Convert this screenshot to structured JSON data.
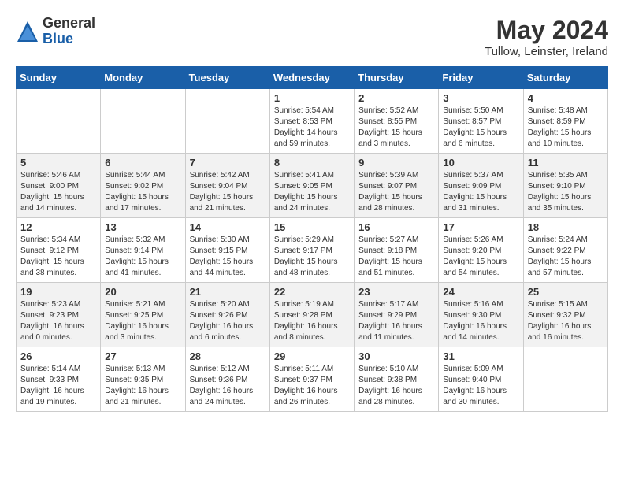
{
  "header": {
    "logo_general": "General",
    "logo_blue": "Blue",
    "month_year": "May 2024",
    "location": "Tullow, Leinster, Ireland"
  },
  "days_of_week": [
    "Sunday",
    "Monday",
    "Tuesday",
    "Wednesday",
    "Thursday",
    "Friday",
    "Saturday"
  ],
  "weeks": [
    [
      {
        "day": "",
        "info": ""
      },
      {
        "day": "",
        "info": ""
      },
      {
        "day": "",
        "info": ""
      },
      {
        "day": "1",
        "info": "Sunrise: 5:54 AM\nSunset: 8:53 PM\nDaylight: 14 hours\nand 59 minutes."
      },
      {
        "day": "2",
        "info": "Sunrise: 5:52 AM\nSunset: 8:55 PM\nDaylight: 15 hours\nand 3 minutes."
      },
      {
        "day": "3",
        "info": "Sunrise: 5:50 AM\nSunset: 8:57 PM\nDaylight: 15 hours\nand 6 minutes."
      },
      {
        "day": "4",
        "info": "Sunrise: 5:48 AM\nSunset: 8:59 PM\nDaylight: 15 hours\nand 10 minutes."
      }
    ],
    [
      {
        "day": "5",
        "info": "Sunrise: 5:46 AM\nSunset: 9:00 PM\nDaylight: 15 hours\nand 14 minutes."
      },
      {
        "day": "6",
        "info": "Sunrise: 5:44 AM\nSunset: 9:02 PM\nDaylight: 15 hours\nand 17 minutes."
      },
      {
        "day": "7",
        "info": "Sunrise: 5:42 AM\nSunset: 9:04 PM\nDaylight: 15 hours\nand 21 minutes."
      },
      {
        "day": "8",
        "info": "Sunrise: 5:41 AM\nSunset: 9:05 PM\nDaylight: 15 hours\nand 24 minutes."
      },
      {
        "day": "9",
        "info": "Sunrise: 5:39 AM\nSunset: 9:07 PM\nDaylight: 15 hours\nand 28 minutes."
      },
      {
        "day": "10",
        "info": "Sunrise: 5:37 AM\nSunset: 9:09 PM\nDaylight: 15 hours\nand 31 minutes."
      },
      {
        "day": "11",
        "info": "Sunrise: 5:35 AM\nSunset: 9:10 PM\nDaylight: 15 hours\nand 35 minutes."
      }
    ],
    [
      {
        "day": "12",
        "info": "Sunrise: 5:34 AM\nSunset: 9:12 PM\nDaylight: 15 hours\nand 38 minutes."
      },
      {
        "day": "13",
        "info": "Sunrise: 5:32 AM\nSunset: 9:14 PM\nDaylight: 15 hours\nand 41 minutes."
      },
      {
        "day": "14",
        "info": "Sunrise: 5:30 AM\nSunset: 9:15 PM\nDaylight: 15 hours\nand 44 minutes."
      },
      {
        "day": "15",
        "info": "Sunrise: 5:29 AM\nSunset: 9:17 PM\nDaylight: 15 hours\nand 48 minutes."
      },
      {
        "day": "16",
        "info": "Sunrise: 5:27 AM\nSunset: 9:18 PM\nDaylight: 15 hours\nand 51 minutes."
      },
      {
        "day": "17",
        "info": "Sunrise: 5:26 AM\nSunset: 9:20 PM\nDaylight: 15 hours\nand 54 minutes."
      },
      {
        "day": "18",
        "info": "Sunrise: 5:24 AM\nSunset: 9:22 PM\nDaylight: 15 hours\nand 57 minutes."
      }
    ],
    [
      {
        "day": "19",
        "info": "Sunrise: 5:23 AM\nSunset: 9:23 PM\nDaylight: 16 hours\nand 0 minutes."
      },
      {
        "day": "20",
        "info": "Sunrise: 5:21 AM\nSunset: 9:25 PM\nDaylight: 16 hours\nand 3 minutes."
      },
      {
        "day": "21",
        "info": "Sunrise: 5:20 AM\nSunset: 9:26 PM\nDaylight: 16 hours\nand 6 minutes."
      },
      {
        "day": "22",
        "info": "Sunrise: 5:19 AM\nSunset: 9:28 PM\nDaylight: 16 hours\nand 8 minutes."
      },
      {
        "day": "23",
        "info": "Sunrise: 5:17 AM\nSunset: 9:29 PM\nDaylight: 16 hours\nand 11 minutes."
      },
      {
        "day": "24",
        "info": "Sunrise: 5:16 AM\nSunset: 9:30 PM\nDaylight: 16 hours\nand 14 minutes."
      },
      {
        "day": "25",
        "info": "Sunrise: 5:15 AM\nSunset: 9:32 PM\nDaylight: 16 hours\nand 16 minutes."
      }
    ],
    [
      {
        "day": "26",
        "info": "Sunrise: 5:14 AM\nSunset: 9:33 PM\nDaylight: 16 hours\nand 19 minutes."
      },
      {
        "day": "27",
        "info": "Sunrise: 5:13 AM\nSunset: 9:35 PM\nDaylight: 16 hours\nand 21 minutes."
      },
      {
        "day": "28",
        "info": "Sunrise: 5:12 AM\nSunset: 9:36 PM\nDaylight: 16 hours\nand 24 minutes."
      },
      {
        "day": "29",
        "info": "Sunrise: 5:11 AM\nSunset: 9:37 PM\nDaylight: 16 hours\nand 26 minutes."
      },
      {
        "day": "30",
        "info": "Sunrise: 5:10 AM\nSunset: 9:38 PM\nDaylight: 16 hours\nand 28 minutes."
      },
      {
        "day": "31",
        "info": "Sunrise: 5:09 AM\nSunset: 9:40 PM\nDaylight: 16 hours\nand 30 minutes."
      },
      {
        "day": "",
        "info": ""
      }
    ]
  ]
}
